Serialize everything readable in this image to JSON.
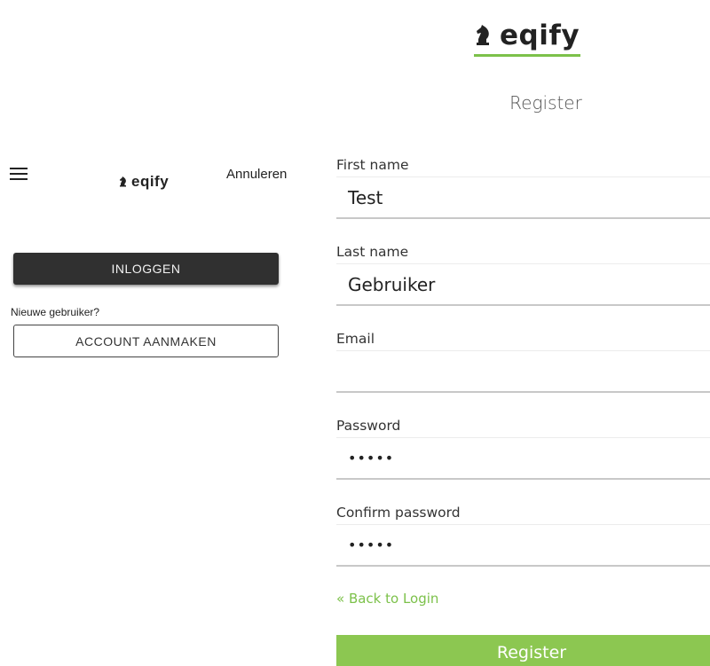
{
  "brand": {
    "name": "eqify",
    "accent_color": "#7cc14a",
    "logo_icon": "chess-knight-icon"
  },
  "register": {
    "title": "Register",
    "fields": [
      {
        "label": "First name",
        "value": "Test"
      },
      {
        "label": "Last name",
        "value": "Gebruiker"
      },
      {
        "label": "Email",
        "value": ""
      },
      {
        "label": "Password",
        "value": "•••••"
      },
      {
        "label": "Confirm password",
        "value": "•••••"
      }
    ],
    "back_link": "« Back to Login",
    "submit_label": "Register"
  },
  "mobile": {
    "menu_icon": "hamburger-menu-icon",
    "cancel_label": "Annuleren",
    "login_label": "INLOGGEN",
    "new_user_text": "Nieuwe gebruiker?",
    "create_account_label": "ACCOUNT AANMAKEN"
  }
}
